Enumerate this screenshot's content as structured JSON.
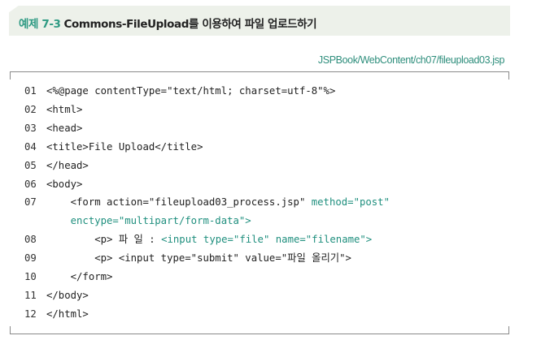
{
  "title": {
    "number": "예제 7-3",
    "text": "Commons-FileUpload를 이용하여 파일 업로드하기"
  },
  "file_path": "JSPBook/WebContent/ch07/fileupload03.jsp",
  "lines": [
    {
      "num": "01",
      "segments": [
        {
          "text": "<%@page contentType=\"text/html; charset=utf-8\"%>",
          "accent": false
        }
      ]
    },
    {
      "num": "02",
      "segments": [
        {
          "text": "<html>",
          "accent": false
        }
      ]
    },
    {
      "num": "03",
      "segments": [
        {
          "text": "<head>",
          "accent": false
        }
      ]
    },
    {
      "num": "04",
      "segments": [
        {
          "text": "<title>File Upload</title>",
          "accent": false
        }
      ]
    },
    {
      "num": "05",
      "segments": [
        {
          "text": "</head>",
          "accent": false
        }
      ]
    },
    {
      "num": "06",
      "segments": [
        {
          "text": "<body>",
          "accent": false
        }
      ]
    },
    {
      "num": "07",
      "segments": [
        {
          "text": "    <form action=\"fileupload03_process.jsp\" ",
          "accent": false
        },
        {
          "text": "method=\"post\"",
          "accent": true
        }
      ]
    },
    {
      "num": "",
      "segments": [
        {
          "text": "    enctype=\"multipart/form-data\">",
          "accent": true
        }
      ]
    },
    {
      "num": "08",
      "segments": [
        {
          "text": "        <p> 파 일 : ",
          "accent": false
        },
        {
          "text": "<input type=\"file\" name=\"filename\">",
          "accent": true
        }
      ]
    },
    {
      "num": "09",
      "segments": [
        {
          "text": "        <p> <input type=\"submit\" value=\"파일 올리기\">",
          "accent": false
        }
      ]
    },
    {
      "num": "10",
      "segments": [
        {
          "text": "    </form>",
          "accent": false
        }
      ]
    },
    {
      "num": "11",
      "segments": [
        {
          "text": "</body>",
          "accent": false
        }
      ]
    },
    {
      "num": "12",
      "segments": [
        {
          "text": "</html>",
          "accent": false
        }
      ]
    }
  ],
  "colors": {
    "accent": "#1f8f7e",
    "title_number": "#2e9a83",
    "title_background": "#edf1ea",
    "file_path": "#2e8e7c"
  }
}
